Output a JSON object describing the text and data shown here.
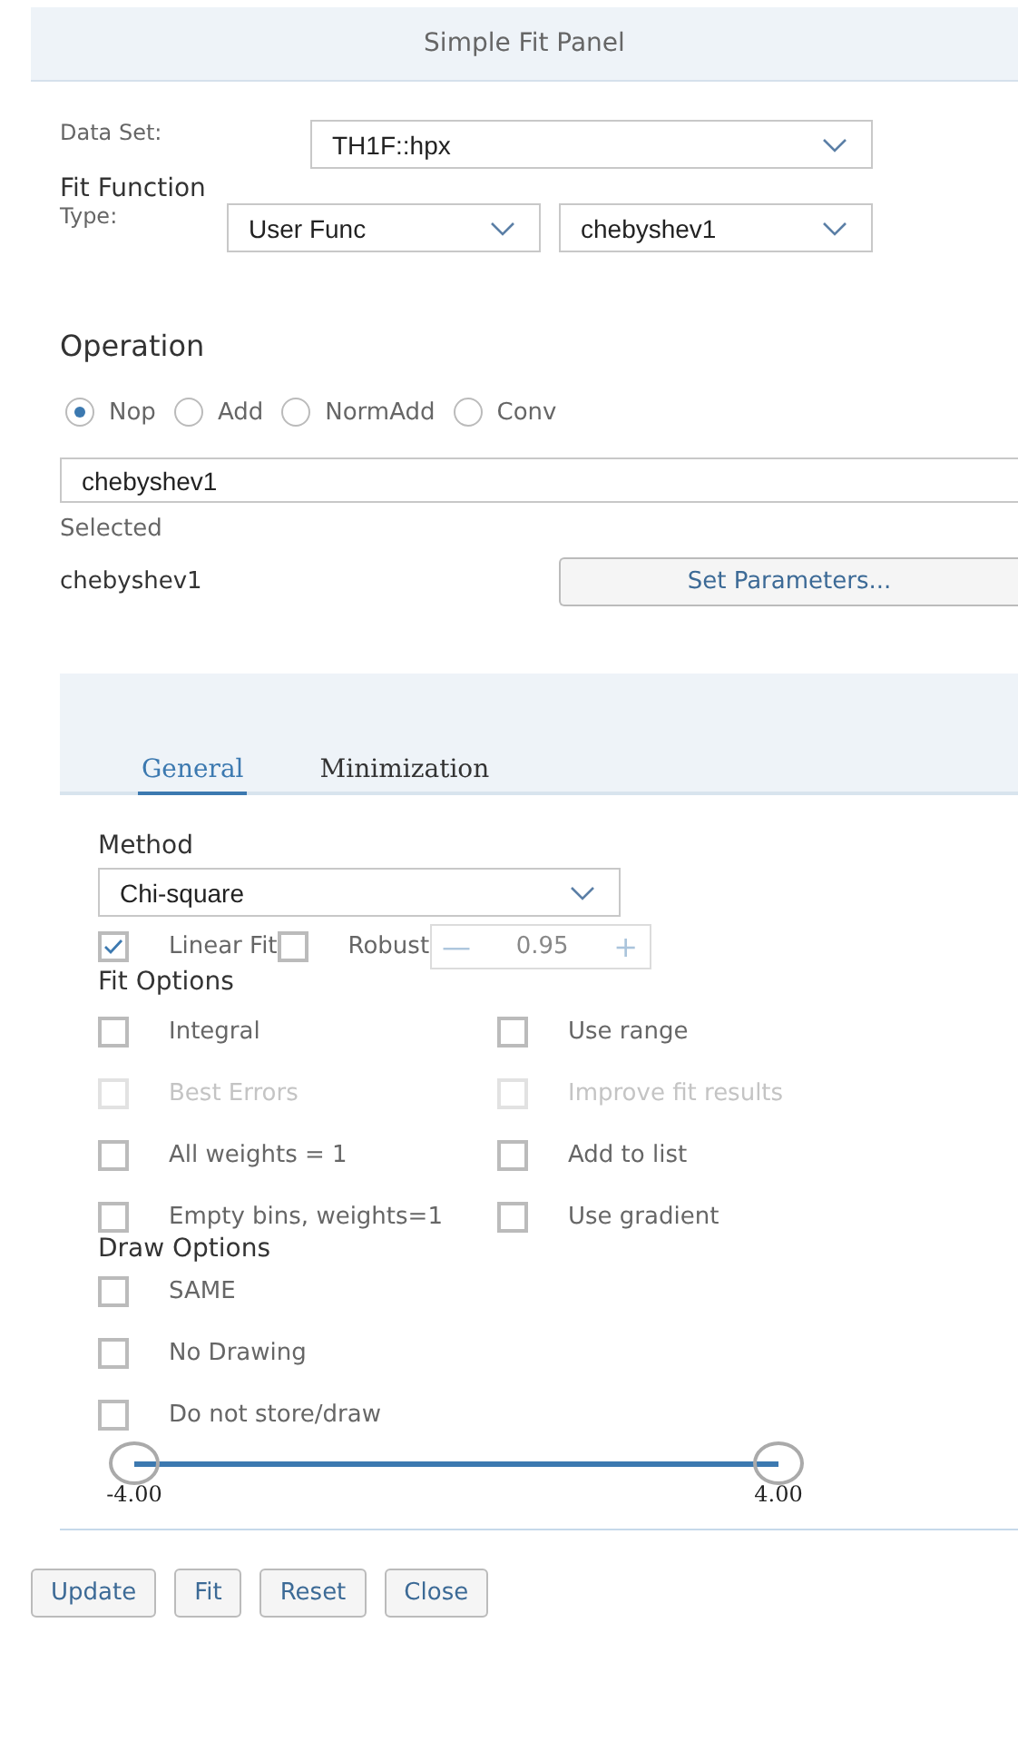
{
  "window": {
    "title": "Simple Fit Panel"
  },
  "data_set": {
    "label": "Data Set:",
    "value": "TH1F::hpx"
  },
  "fit_function": {
    "heading": "Fit Function",
    "type_label": "Type:",
    "type_value": "User Func",
    "function_value": "chebyshev1"
  },
  "operation": {
    "heading": "Operation",
    "options": [
      {
        "label": "Nop",
        "selected": true
      },
      {
        "label": "Add",
        "selected": false
      },
      {
        "label": "NormAdd",
        "selected": false
      },
      {
        "label": "Conv",
        "selected": false
      }
    ],
    "formula": "chebyshev1",
    "selected_label": "Selected",
    "selected_value": "chebyshev1",
    "set_parameters": "Set Parameters..."
  },
  "tabs": [
    {
      "label": "General",
      "selected": true
    },
    {
      "label": "Minimization",
      "selected": false
    }
  ],
  "method": {
    "heading": "Method",
    "value": "Chi-square",
    "linear_fit": {
      "label": "Linear Fit",
      "checked": true
    },
    "robust": {
      "label": "Robust",
      "checked": false,
      "minus": "—",
      "value": "0.95",
      "plus": "+"
    }
  },
  "fit_options": {
    "heading": "Fit Options",
    "items": [
      {
        "label": "Integral",
        "checked": false,
        "disabled": false
      },
      {
        "label": "Use range",
        "checked": false,
        "disabled": false
      },
      {
        "label": "Best Errors",
        "checked": false,
        "disabled": true
      },
      {
        "label": "Improve fit results",
        "checked": false,
        "disabled": true
      },
      {
        "label": "All weights = 1",
        "checked": false,
        "disabled": false
      },
      {
        "label": "Add to list",
        "checked": false,
        "disabled": false
      },
      {
        "label": "Empty bins, weights=1",
        "checked": false,
        "disabled": false
      },
      {
        "label": "Use gradient",
        "checked": false,
        "disabled": false
      }
    ]
  },
  "draw_options": {
    "heading": "Draw Options",
    "items": [
      {
        "label": "SAME",
        "checked": false
      },
      {
        "label": "No Drawing",
        "checked": false
      },
      {
        "label": "Do not store/draw",
        "checked": false
      }
    ]
  },
  "range": {
    "thumbs": [
      {
        "level": 0,
        "label": "-4.00"
      },
      {
        "level": 1,
        "label": "4.00"
      }
    ]
  },
  "buttons": [
    "Update",
    "Fit",
    "Reset",
    "Close"
  ]
}
